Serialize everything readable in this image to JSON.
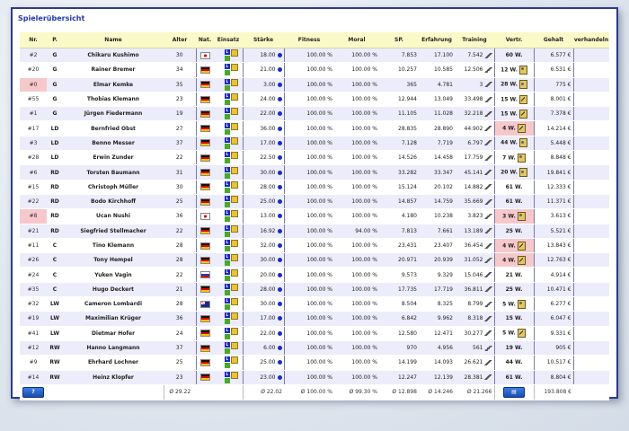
{
  "window": {
    "title": "Spielerübersicht"
  },
  "columns": {
    "nr": "Nr.",
    "pos": "P.",
    "name": "Name",
    "age": "Alter",
    "nat": "Nat.",
    "einsatz": "Einsatz",
    "staerke": "Stärke",
    "fitness": "Fitness",
    "moral": "Moral",
    "sp": "SP.",
    "erfahrung": "Erfahrung",
    "training": "Training",
    "vertr": "Vertr.",
    "gehalt": "Gehalt",
    "verhandeln": "verhandeln"
  },
  "colors": {
    "border": "#2d3a8c",
    "header_bg": "#fafac8",
    "row_alt": "#ececfb",
    "highlight": "#f6c8cc",
    "accent": "#2338b0"
  },
  "players": [
    {
      "nr": "#2",
      "pos": "G",
      "name": "Chikaru Kushimo",
      "age": "30",
      "nat": "jp",
      "st": "18.00",
      "fit": "100.00 %",
      "mor": "100.00 %",
      "sp": "7.853",
      "erf": "17.100",
      "tr": "7.542",
      "vert": "60 W.",
      "ico": "",
      "geh": "6.577 €",
      "pink": false,
      "nrpink": false
    },
    {
      "nr": "#20",
      "pos": "G",
      "name": "Rainer Bremer",
      "age": "34",
      "nat": "de",
      "st": "21.00",
      "fit": "100.00 %",
      "mor": "100.00 %",
      "sp": "10.257",
      "erf": "10.585",
      "tr": "12.506",
      "vert": "12 W.",
      "ico": "medal",
      "geh": "6.531 €",
      "pink": false,
      "nrpink": false
    },
    {
      "nr": "#0",
      "pos": "G",
      "name": "Elmar Kemke",
      "age": "35",
      "nat": "de",
      "st": "3.00",
      "fit": "100.00 %",
      "mor": "100.00 %",
      "sp": "365",
      "erf": "4.781",
      "tr": "3",
      "vert": "28 W.",
      "ico": "medal",
      "geh": "775 €",
      "pink": false,
      "nrpink": true
    },
    {
      "nr": "#55",
      "pos": "G",
      "name": "Thobias Klemann",
      "age": "23",
      "nat": "de",
      "st": "24.00",
      "fit": "100.00 %",
      "mor": "100.00 %",
      "sp": "12.944",
      "erf": "13.049",
      "tr": "33.498",
      "vert": "15 W.",
      "ico": "pen",
      "geh": "8.001 €",
      "pink": false,
      "nrpink": false
    },
    {
      "nr": "#1",
      "pos": "G",
      "name": "Jürgen Fiedermann",
      "age": "19",
      "nat": "de",
      "st": "22.00",
      "fit": "100.00 %",
      "mor": "100.00 %",
      "sp": "11.105",
      "erf": "11.028",
      "tr": "32.218",
      "vert": "15 W.",
      "ico": "pen",
      "geh": "7.378 €",
      "pink": false,
      "nrpink": false
    },
    {
      "nr": "#17",
      "pos": "LD",
      "name": "Bernfried Obst",
      "age": "27",
      "nat": "de",
      "st": "36.00",
      "fit": "100.00 %",
      "mor": "100.00 %",
      "sp": "28.835",
      "erf": "28.890",
      "tr": "44.902",
      "vert": "4 W.",
      "ico": "pen",
      "geh": "14.214 €",
      "pink": true,
      "nrpink": false
    },
    {
      "nr": "#3",
      "pos": "LD",
      "name": "Benno Messer",
      "age": "37",
      "nat": "de",
      "st": "17.00",
      "fit": "100.00 %",
      "mor": "100.00 %",
      "sp": "7.128",
      "erf": "7.719",
      "tr": "6.797",
      "vert": "44 W.",
      "ico": "medal",
      "geh": "5.448 €",
      "pink": false,
      "nrpink": false
    },
    {
      "nr": "#28",
      "pos": "LD",
      "name": "Erwin Zunder",
      "age": "22",
      "nat": "de",
      "st": "22.50",
      "fit": "100.00 %",
      "mor": "100.00 %",
      "sp": "14.526",
      "erf": "14.458",
      "tr": "17.759",
      "vert": "7 W.",
      "ico": "medal",
      "geh": "8.848 €",
      "pink": false,
      "nrpink": false
    },
    {
      "nr": "#6",
      "pos": "RD",
      "name": "Torsten Baumann",
      "age": "31",
      "nat": "de",
      "st": "30.00",
      "fit": "100.00 %",
      "mor": "100.00 %",
      "sp": "33.282",
      "erf": "33.347",
      "tr": "45.141",
      "vert": "20 W.",
      "ico": "medal",
      "geh": "19.841 €",
      "pink": false,
      "nrpink": false
    },
    {
      "nr": "#15",
      "pos": "RD",
      "name": "Christoph Müller",
      "age": "30",
      "nat": "de",
      "st": "28.00",
      "fit": "100.00 %",
      "mor": "100.00 %",
      "sp": "15.124",
      "erf": "20.102",
      "tr": "14.882",
      "vert": "61 W.",
      "ico": "",
      "geh": "12.333 €",
      "pink": false,
      "nrpink": false
    },
    {
      "nr": "#22",
      "pos": "RD",
      "name": "Bodo Kirchhoff",
      "age": "25",
      "nat": "de",
      "st": "25.00",
      "fit": "100.00 %",
      "mor": "100.00 %",
      "sp": "14.857",
      "erf": "14.759",
      "tr": "35.669",
      "vert": "61 W.",
      "ico": "",
      "geh": "11.371 €",
      "pink": false,
      "nrpink": false
    },
    {
      "nr": "#8",
      "pos": "RD",
      "name": "Ucan Nushi",
      "age": "36",
      "nat": "jp",
      "st": "13.00",
      "fit": "100.00 %",
      "mor": "100.00 %",
      "sp": "4.180",
      "erf": "10.238",
      "tr": "3.823",
      "vert": "3 W.",
      "ico": "medal",
      "geh": "3.613 €",
      "pink": true,
      "nrpink": true
    },
    {
      "nr": "#21",
      "pos": "RD",
      "name": "Siegfried Stellmacher",
      "age": "22",
      "nat": "de",
      "st": "16.92",
      "fit": "100.00 %",
      "mor": "94.00 %",
      "sp": "7.813",
      "erf": "7.661",
      "tr": "13.189",
      "vert": "25 W.",
      "ico": "",
      "geh": "5.521 €",
      "pink": false,
      "nrpink": false
    },
    {
      "nr": "#11",
      "pos": "C",
      "name": "Tino Klemann",
      "age": "28",
      "nat": "de",
      "st": "32.00",
      "fit": "100.00 %",
      "mor": "100.00 %",
      "sp": "23.431",
      "erf": "23.407",
      "tr": "36.454",
      "vert": "4 W.",
      "ico": "pen",
      "geh": "13.843 €",
      "pink": true,
      "nrpink": false
    },
    {
      "nr": "#26",
      "pos": "C",
      "name": "Tony Hempel",
      "age": "28",
      "nat": "de",
      "st": "30.00",
      "fit": "100.00 %",
      "mor": "100.00 %",
      "sp": "20.971",
      "erf": "20.939",
      "tr": "31.052",
      "vert": "4 W.",
      "ico": "pen",
      "geh": "12.763 €",
      "pink": true,
      "nrpink": false
    },
    {
      "nr": "#24",
      "pos": "C",
      "name": "Yuken Vagin",
      "age": "22",
      "nat": "ru",
      "st": "20.00",
      "fit": "100.00 %",
      "mor": "100.00 %",
      "sp": "9.573",
      "erf": "9.329",
      "tr": "15.046",
      "vert": "21 W.",
      "ico": "",
      "geh": "4.914 €",
      "pink": false,
      "nrpink": false
    },
    {
      "nr": "#35",
      "pos": "C",
      "name": "Hugo Deckert",
      "age": "21",
      "nat": "de",
      "st": "28.00",
      "fit": "100.00 %",
      "mor": "100.00 %",
      "sp": "17.735",
      "erf": "17.719",
      "tr": "36.811",
      "vert": "25 W.",
      "ico": "",
      "geh": "10.471 €",
      "pink": false,
      "nrpink": false
    },
    {
      "nr": "#32",
      "pos": "LW",
      "name": "Cameron Lombardi",
      "age": "28",
      "nat": "au",
      "st": "30.00",
      "fit": "100.00 %",
      "mor": "100.00 %",
      "sp": "8.504",
      "erf": "8.325",
      "tr": "8.799",
      "vert": "5 W.",
      "ico": "medal",
      "geh": "6.277 €",
      "pink": false,
      "nrpink": false
    },
    {
      "nr": "#19",
      "pos": "LW",
      "name": "Maximilian Krüger",
      "age": "36",
      "nat": "de",
      "st": "17.00",
      "fit": "100.00 %",
      "mor": "100.00 %",
      "sp": "6.842",
      "erf": "9.962",
      "tr": "8.318",
      "vert": "15 W.",
      "ico": "",
      "geh": "6.047 €",
      "pink": false,
      "nrpink": false
    },
    {
      "nr": "#41",
      "pos": "LW",
      "name": "Dietmar Hofer",
      "age": "24",
      "nat": "de",
      "st": "22.00",
      "fit": "100.00 %",
      "mor": "100.00 %",
      "sp": "12.580",
      "erf": "12.471",
      "tr": "30.277",
      "vert": "5 W.",
      "ico": "pen",
      "geh": "9.331 €",
      "pink": false,
      "nrpink": false
    },
    {
      "nr": "#12",
      "pos": "RW",
      "name": "Hanno Langmann",
      "age": "37",
      "nat": "de",
      "st": "6.00",
      "fit": "100.00 %",
      "mor": "100.00 %",
      "sp": "970",
      "erf": "4.956",
      "tr": "561",
      "vert": "19 W.",
      "ico": "",
      "geh": "905 €",
      "pink": false,
      "nrpink": false
    },
    {
      "nr": "#9",
      "pos": "RW",
      "name": "Ehrhard Lochner",
      "age": "25",
      "nat": "de",
      "st": "25.00",
      "fit": "100.00 %",
      "mor": "100.00 %",
      "sp": "14.199",
      "erf": "14.093",
      "tr": "26.621",
      "vert": "44 W.",
      "ico": "",
      "geh": "10.517 €",
      "pink": false,
      "nrpink": false
    },
    {
      "nr": "#14",
      "pos": "RW",
      "name": "Heinz Klopfer",
      "age": "23",
      "nat": "de",
      "st": "23.00",
      "fit": "100.00 %",
      "mor": "100.00 %",
      "sp": "12.247",
      "erf": "12.139",
      "tr": "28.381",
      "vert": "61 W.",
      "ico": "",
      "geh": "8.804 €",
      "pink": false,
      "nrpink": false
    }
  ],
  "footer": {
    "help_button": "?",
    "avg_age": "Ø 29.22",
    "avg_strength": "Ø 22.02",
    "avg_fitness": "Ø 100.00 %",
    "avg_moral": "Ø 99.30 %",
    "avg_sp": "Ø 12.898",
    "avg_erf": "Ø 14.246",
    "avg_training": "Ø 21.266",
    "total_gehalt": "193.808 €"
  }
}
